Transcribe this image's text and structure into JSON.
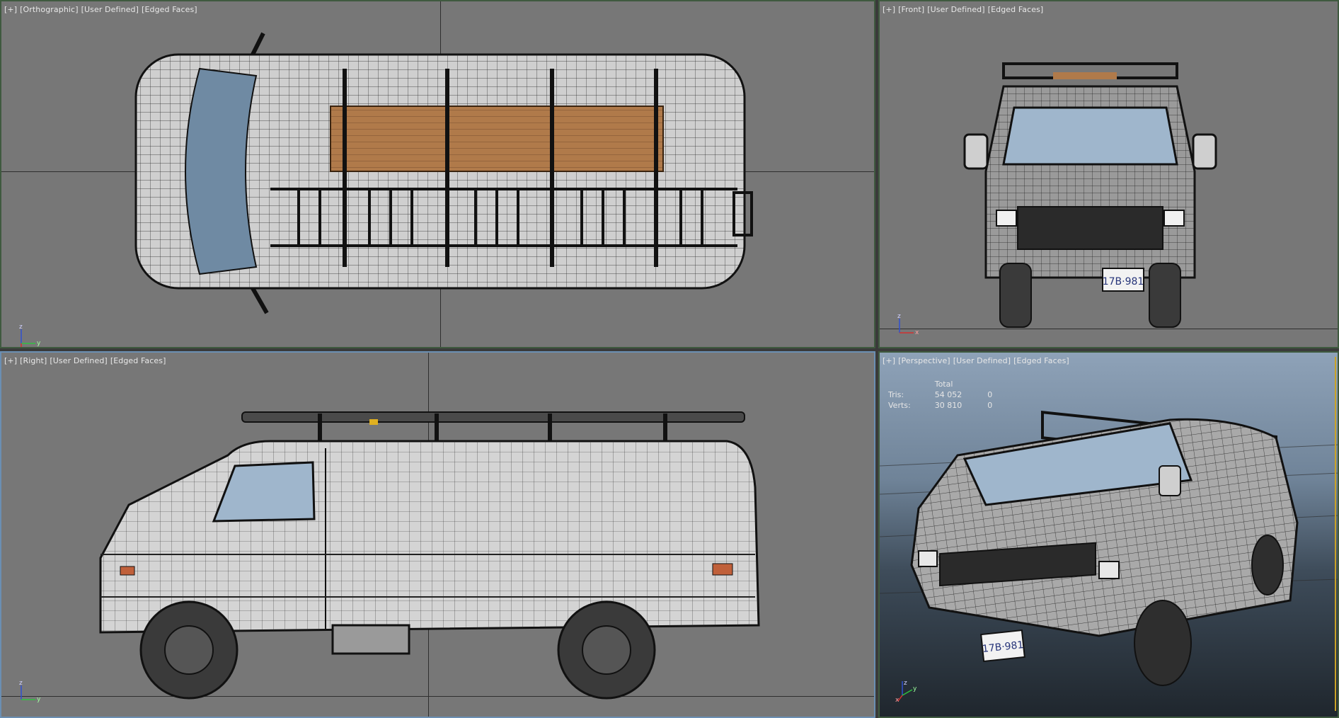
{
  "viewports": {
    "top": {
      "label": [
        "[+]",
        "[Orthographic]",
        "[User Defined]",
        "[Edged Faces]"
      ]
    },
    "front": {
      "label": [
        "[+]",
        "[Front]",
        "[User Defined]",
        "[Edged Faces]"
      ]
    },
    "right": {
      "label": [
        "[+]",
        "[Right]",
        "[User Defined]",
        "[Edged Faces]"
      ]
    },
    "perspective": {
      "label": [
        "[+]",
        "[Perspective]",
        "[User Defined]",
        "[Edged Faces]"
      ]
    }
  },
  "stats": {
    "header": "Total",
    "tris_label": "Tris:",
    "tris_value": "54 052",
    "tris_sel": "0",
    "verts_label": "Verts:",
    "verts_value": "30 810",
    "verts_sel": "0"
  },
  "license_plate": "17B·981",
  "axis_letters": {
    "x": "x",
    "y": "y",
    "z": "z"
  },
  "colors": {
    "active_border": "#6b8fb3",
    "inactive_border": "#3f5a3f",
    "viewport_bg": "#777777",
    "wood": "#b07a4a",
    "glass": "#9fb6cc"
  }
}
